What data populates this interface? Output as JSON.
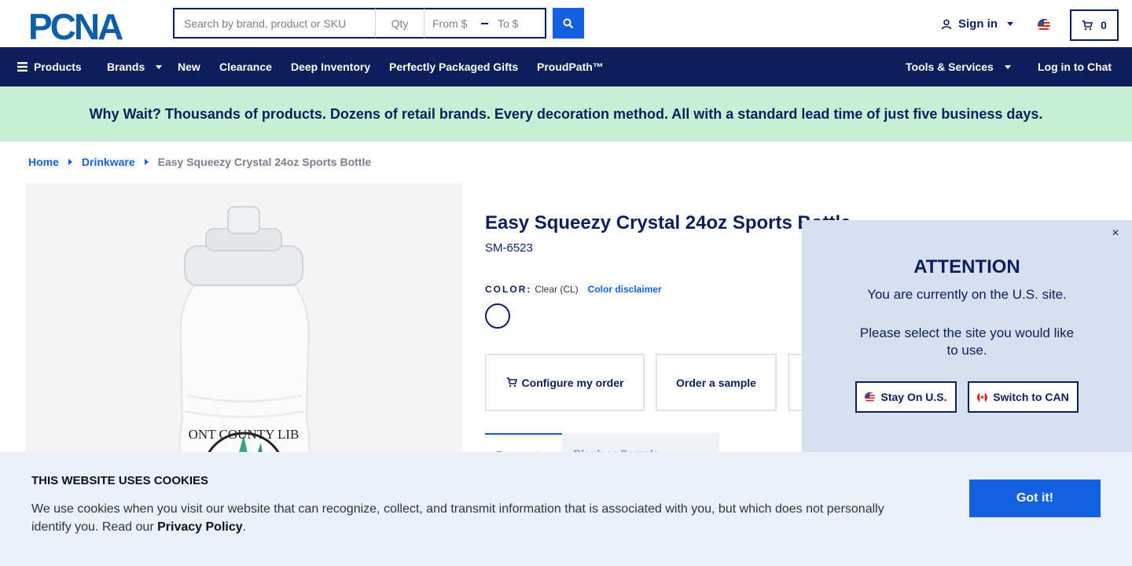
{
  "header": {
    "logo_text": "PCNA",
    "search_placeholder": "Search by brand, product or SKU",
    "qty_placeholder": "Qty",
    "from_placeholder": "From $",
    "to_placeholder": "To $",
    "signin_label": "Sign in",
    "cart_count": "0"
  },
  "nav": {
    "products": "Products",
    "brands": "Brands",
    "new": "New",
    "clearance": "Clearance",
    "deep_inventory": "Deep Inventory",
    "gifts": "Perfectly Packaged Gifts",
    "proudpath": "ProudPath™",
    "tools": "Tools & Services",
    "chat": "Log in to Chat"
  },
  "promo": {
    "text": "Why Wait? Thousands of products. Dozens of retail brands. Every decoration method. All with a standard lead time of just five business days."
  },
  "breadcrumb": {
    "home": "Home",
    "category": "Drinkware",
    "current": "Easy Squeezy Crystal 24oz Sports Bottle"
  },
  "product": {
    "title": "Easy Squeezy Crystal 24oz Sports Bottle",
    "sku": "SM-6523",
    "color_label": "COLOR:",
    "color_value": "Clear (CL)",
    "color_disclaimer": "Color disclaimer",
    "image_imprint": "ONT COUNTY LIB",
    "actions": {
      "configure": "Configure my order",
      "sample": "Order a sample"
    },
    "tabs": {
      "active": "Request",
      "inactive": "Blank or Sample"
    }
  },
  "attention": {
    "title": "ATTENTION",
    "line1": "You are currently on the U.S. site.",
    "line2": "Please select the site you would like to use.",
    "stay": "Stay On U.S.",
    "switch": "Switch to CAN",
    "close": "×"
  },
  "cookie": {
    "title": "THIS WEBSITE USES COOKIES",
    "text": "We use cookies when you visit our website that can recognize, collect, and transmit information that is associated with you, but which does not personally identify you. Read our",
    "privacy": "Privacy Policy",
    "period": ".",
    "button": "Got it!"
  },
  "colors": {
    "navy": "#0c1f5a",
    "blue": "#1560e0",
    "promo_bg": "#c6efd6",
    "cookie_bg": "#eaf1fa",
    "attention_bg": "#d6e0f0"
  },
  "icons": {
    "search": "search-icon",
    "user": "user-icon",
    "cart": "cart-icon",
    "menu": "menu-icon",
    "close": "close-icon"
  }
}
